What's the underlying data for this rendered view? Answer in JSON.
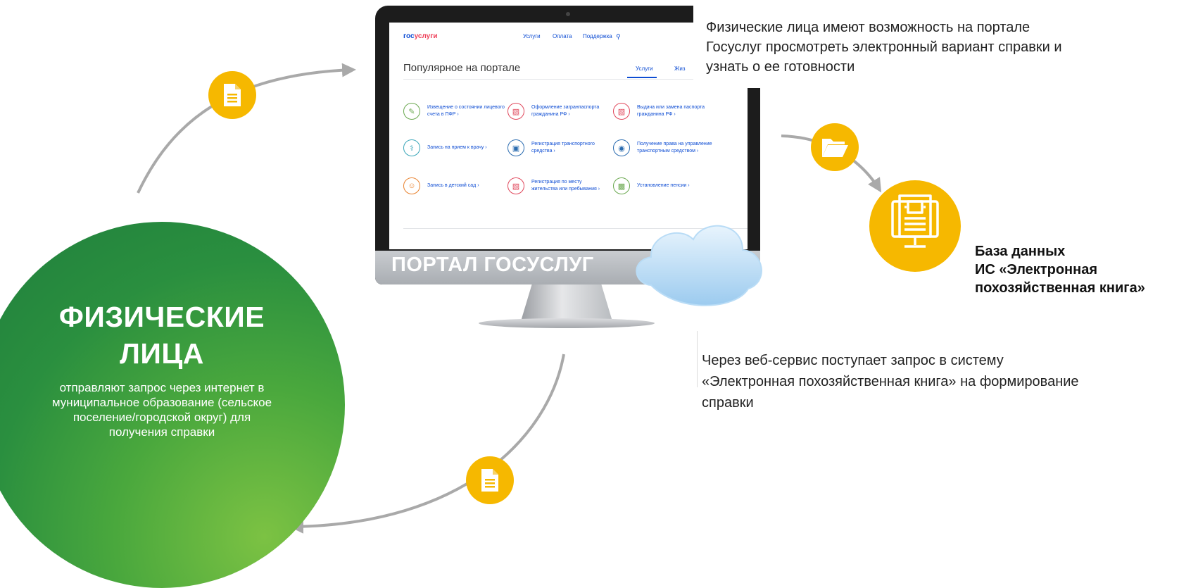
{
  "individuals": {
    "title_line1": "ФИЗИЧЕСКИЕ",
    "title_line2": "ЛИЦА",
    "description": "отправляют запрос через интернет в муниципальное образование (сельское поселение/городской округ) для получения справки"
  },
  "portal": {
    "label": "ПОРТАЛ ГОСУСЛУГ",
    "logo_main": "гос",
    "logo_accent": "услуги",
    "nav": [
      "Услуги",
      "Оплата",
      "Поддержка"
    ],
    "title": "Популярное на портале",
    "tabs": [
      "Услуги",
      "Жиз"
    ],
    "services": [
      {
        "label": "Извещение о состоянии лицевого счета в ПФР ›",
        "color": "#6aa84f"
      },
      {
        "label": "Оформление загранпаспорта гражданина РФ ›",
        "color": "#e0475b"
      },
      {
        "label": "Выдача или замена паспорта гражданина РФ ›",
        "color": "#e0475b"
      },
      {
        "label": "Запись на прием к врачу ›",
        "color": "#3aa6b9"
      },
      {
        "label": "Регистрация транспортного средства ›",
        "color": "#2b6cb0"
      },
      {
        "label": "Получение права на управление транспортным средством ›",
        "color": "#2b6cb0"
      },
      {
        "label": "Запись в детский сад ›",
        "color": "#e9822e"
      },
      {
        "label": "Регистрация по месту жительства или пребывания ›",
        "color": "#e0475b"
      },
      {
        "label": "Установление пенсии ›",
        "color": "#6aa84f"
      }
    ]
  },
  "texts": {
    "portal_info": "Физические лица имеют возможность на портале Госуслуг просмотреть электронный вариант справки и узнать о ее готовности",
    "database_line1": "База данных",
    "database_line2": "ИС «Электронная",
    "database_line3": "похозяйственная книга»",
    "webservice": "Через веб-сервис поступает запрос в систему «Электронная похозяйственная книга» на формирование справки"
  },
  "colors": {
    "accent_yellow": "#f6b800",
    "green_dark": "#1f7e3c",
    "green_light": "#7cc243",
    "arrow_gray": "#a9a9a9",
    "gosuslugi_blue": "#0d4cd3"
  },
  "icons": [
    "document-icon",
    "folder-icon",
    "database-book-icon",
    "cloud-icon"
  ]
}
